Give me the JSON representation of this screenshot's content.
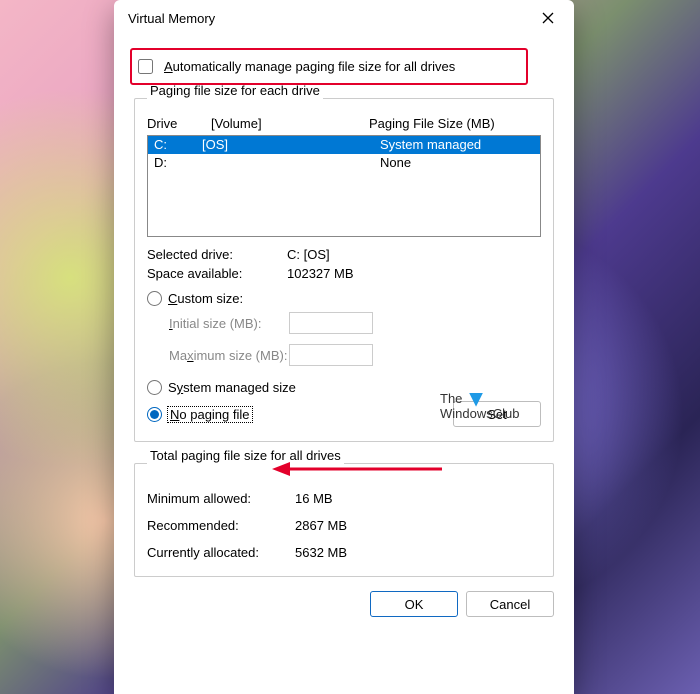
{
  "window": {
    "title": "Virtual Memory"
  },
  "auto_manage": {
    "label": "Automatically manage paging file size for all drives",
    "checked": false
  },
  "drives_group": {
    "legend": "Paging file size for each drive",
    "col_drive": "Drive",
    "col_vol": "[Volume]",
    "col_size": "Paging File Size (MB)",
    "rows": [
      {
        "drive": "C:",
        "vol": "[OS]",
        "size": "System managed",
        "selected": true
      },
      {
        "drive": "D:",
        "vol": "",
        "size": "None",
        "selected": false
      }
    ],
    "selected_drive_label": "Selected drive:",
    "selected_drive_value": "C:  [OS]",
    "space_label": "Space available:",
    "space_value": "102327 MB",
    "custom_label": "Custom size:",
    "initial_label": "Initial size (MB):",
    "maximum_label": "Maximum size (MB):",
    "system_label": "System managed size",
    "no_paging_label": "No paging file",
    "set_label": "Set"
  },
  "watermark": {
    "line1": "The",
    "line2": "WindowsClub"
  },
  "totals": {
    "legend": "Total paging file size for all drives",
    "min_label": "Minimum allowed:",
    "min_value": "16 MB",
    "rec_label": "Recommended:",
    "rec_value": "2867 MB",
    "cur_label": "Currently allocated:",
    "cur_value": "5632 MB"
  },
  "buttons": {
    "ok": "OK",
    "cancel": "Cancel"
  }
}
